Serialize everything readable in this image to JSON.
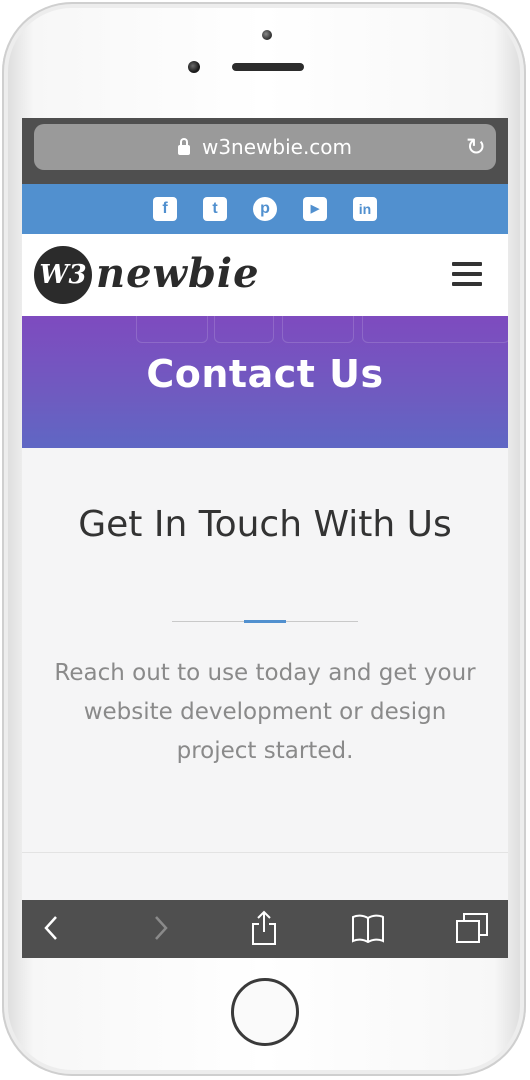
{
  "browser": {
    "url": "w3newbie.com"
  },
  "social": {
    "items": [
      {
        "name": "facebook",
        "glyph": "f"
      },
      {
        "name": "twitter",
        "glyph": "t"
      },
      {
        "name": "pinterest",
        "glyph": "p"
      },
      {
        "name": "youtube",
        "glyph": "▶"
      },
      {
        "name": "linkedin",
        "glyph": "in"
      }
    ],
    "bar_color": "#5190cf"
  },
  "header": {
    "logo_mark": "W3",
    "logo_text": "newbie"
  },
  "hero": {
    "title": "Contact Us"
  },
  "main": {
    "heading": "Get In Touch With Us",
    "description": "Reach out to use today and get your website development or design project started."
  },
  "toolbar": {
    "icons": [
      "back-icon",
      "forward-icon",
      "share-icon",
      "bookmarks-icon",
      "tabs-icon"
    ]
  }
}
